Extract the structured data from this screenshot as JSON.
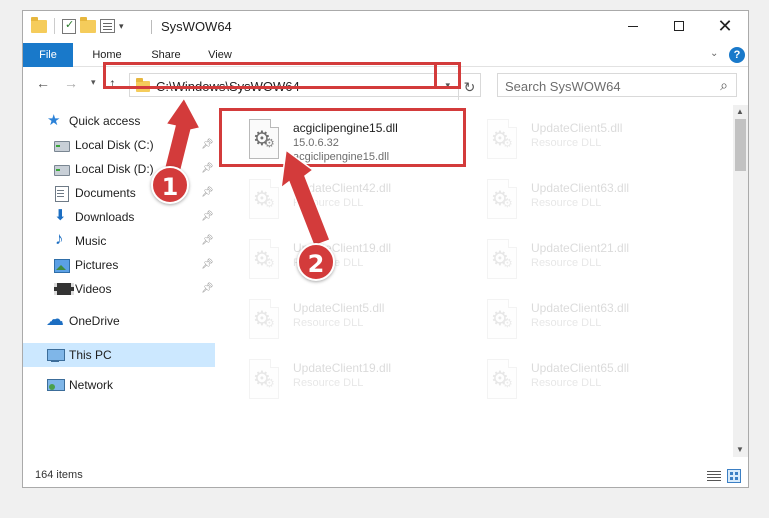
{
  "window": {
    "title": "SysWOW64",
    "controls": {
      "minimize": "minimize",
      "maximize": "maximize",
      "close": "✕"
    }
  },
  "ribbon": {
    "tabs": [
      {
        "label": "File",
        "active": true
      },
      {
        "label": "Home"
      },
      {
        "label": "Share"
      },
      {
        "label": "View"
      }
    ],
    "help": "?"
  },
  "address": {
    "path": "C:\\Windows\\SysWOW64",
    "search_placeholder": "Search SysWOW64"
  },
  "sidebar": {
    "quick_access": "Quick access",
    "items": [
      {
        "label": "Local Disk (C:)",
        "icon": "disk-icon",
        "pinned": true
      },
      {
        "label": "Local Disk (D:)",
        "icon": "disk-icon",
        "pinned": true
      },
      {
        "label": "Documents",
        "icon": "documents-icon",
        "pinned": true
      },
      {
        "label": "Downloads",
        "icon": "downloads-icon",
        "pinned": true
      },
      {
        "label": "Music",
        "icon": "music-icon",
        "pinned": true
      },
      {
        "label": "Pictures",
        "icon": "pictures-icon",
        "pinned": true
      },
      {
        "label": "Videos",
        "icon": "videos-icon",
        "pinned": true
      }
    ],
    "onedrive": "OneDrive",
    "this_pc": "This PC",
    "network": "Network"
  },
  "files": [
    {
      "name": "acgiclipengine15.dll",
      "line2": "15.0.6.32",
      "line3": "acgiclipengine15.dll",
      "faded": false
    },
    {
      "name": "UpdateClient5.dll",
      "line2": "Resource DLL",
      "faded": true
    },
    {
      "name": "UpdateClient42.dll",
      "line2": "Resource DLL",
      "faded": true
    },
    {
      "name": "UpdateClient63.dll",
      "line2": "Resource DLL",
      "faded": true
    },
    {
      "name": "UpdateClient19.dll",
      "line2": "Resource DLL",
      "faded": true
    },
    {
      "name": "UpdateClient21.dll",
      "line2": "Resource DLL",
      "faded": true
    },
    {
      "name": "UpdateClient5.dll",
      "line2": "Resource DLL",
      "faded": true
    },
    {
      "name": "UpdateClient63.dll",
      "line2": "Resource DLL",
      "faded": true
    },
    {
      "name": "UpdateClient19.dll",
      "line2": "Resource DLL",
      "faded": true
    },
    {
      "name": "UpdateClient65.dll",
      "line2": "Resource DLL",
      "faded": true
    }
  ],
  "status": {
    "item_count": "164 items"
  },
  "callouts": {
    "step1": "1",
    "step2": "2",
    "color": "#d33b3b"
  },
  "colors": {
    "accent": "#1979ca",
    "selection": "#cce8ff",
    "highlight": "#d33b3b"
  }
}
